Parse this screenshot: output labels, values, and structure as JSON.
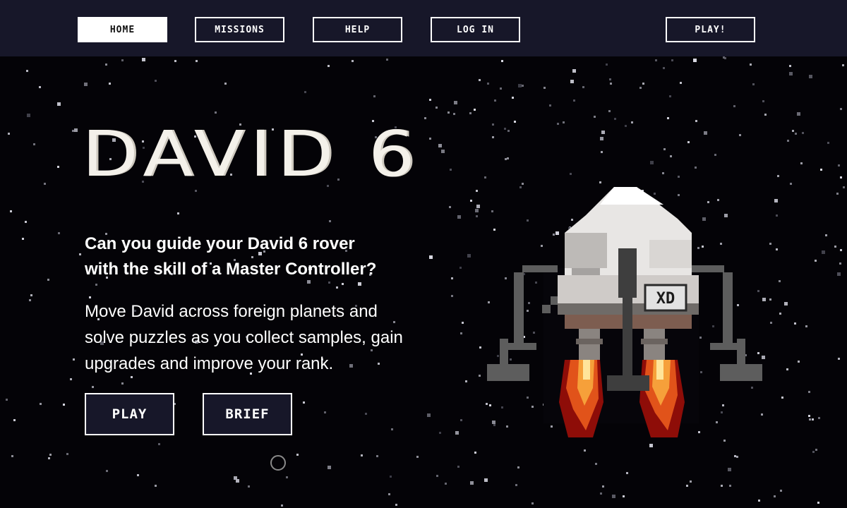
{
  "nav": {
    "home": "HOME",
    "missions": "MISSIONS",
    "help": "HELP",
    "login": "LOG IN",
    "play": "PLAY!"
  },
  "hero": {
    "logo": "DAVID 6",
    "headline_line1": "Can you guide your David 6 rover",
    "headline_line2": "with the skill of a Master Controller?",
    "description_line1": "Move David across foreign planets and",
    "description_line2": "solve puzzles as you collect samples, gain",
    "description_line3": "upgrades and improve your rank.",
    "play_label": "PLAY",
    "brief_label": "BRIEF"
  },
  "rover_badge": "XD",
  "colors": {
    "nav_bg": "#171729",
    "page_bg": "#040307",
    "button_bg": "#171729",
    "flame_orange": "#f07a1e",
    "flame_red": "#a8120c"
  }
}
